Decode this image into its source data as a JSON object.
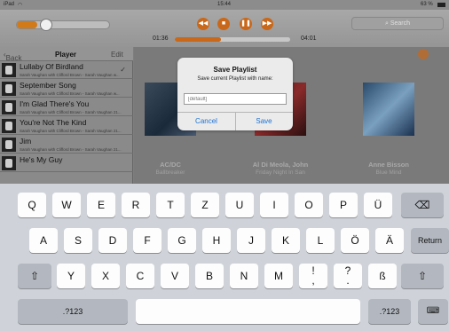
{
  "status": {
    "device": "iPad",
    "time": "15:44",
    "battery": "63 %"
  },
  "player": {
    "time_elapsed": "01:36",
    "time_remaining": "04:01",
    "search_placeholder": "Search",
    "volume": 0.22,
    "progress": 0.4
  },
  "sidebar": {
    "back_label": "Back",
    "title": "Player",
    "edit_label": "Edit",
    "songs": [
      {
        "title": "Lullaby Of Birdland",
        "sub": "Sarah Vaughan with Clifford Brown - Sarah Vaughan w...",
        "checked": "✓"
      },
      {
        "title": "September Song",
        "sub": "Sarah Vaughan with Clifford Brown - Sarah Vaughan w..."
      },
      {
        "title": "I'm Glad There's You",
        "sub": "Sarah Vaughan with Clifford Brown - Sarah Vaughan 21..."
      },
      {
        "title": "You're Not The Kind",
        "sub": "Sarah Vaughan with Clifford Brown - Sarah Vaughan 21..."
      },
      {
        "title": "Jim",
        "sub": "Sarah Vaughan with Clifford Brown - Sarah Vaughan 21..."
      },
      {
        "title": "He's My Guy",
        "sub": ""
      }
    ]
  },
  "albums": [
    {
      "artist": "AC/DC",
      "album": "Ballbreaker"
    },
    {
      "artist": "Al Di Meola, John",
      "album": "Friday Night In San"
    },
    {
      "artist": "Anne Bisson",
      "album": "Blue Mind"
    }
  ],
  "dialog": {
    "title": "Save Playlist",
    "message": "Save current Playlist with name:",
    "placeholder": "[default]",
    "cancel": "Cancel",
    "save": "Save"
  },
  "keyboard": {
    "row1": [
      "Q",
      "W",
      "E",
      "R",
      "T",
      "Z",
      "U",
      "I",
      "O",
      "P",
      "Ü"
    ],
    "row2": [
      "A",
      "S",
      "D",
      "F",
      "G",
      "H",
      "J",
      "K",
      "L",
      "Ö",
      "Ä"
    ],
    "return": "Return",
    "row3": [
      "Y",
      "X",
      "C",
      "V",
      "B",
      "N",
      "M",
      "!\n,",
      "?\n.",
      "ß"
    ],
    "numbers": ".?123"
  },
  "colors": {
    "accent": "#c9681a",
    "dialog_button": "#1a73d6"
  }
}
